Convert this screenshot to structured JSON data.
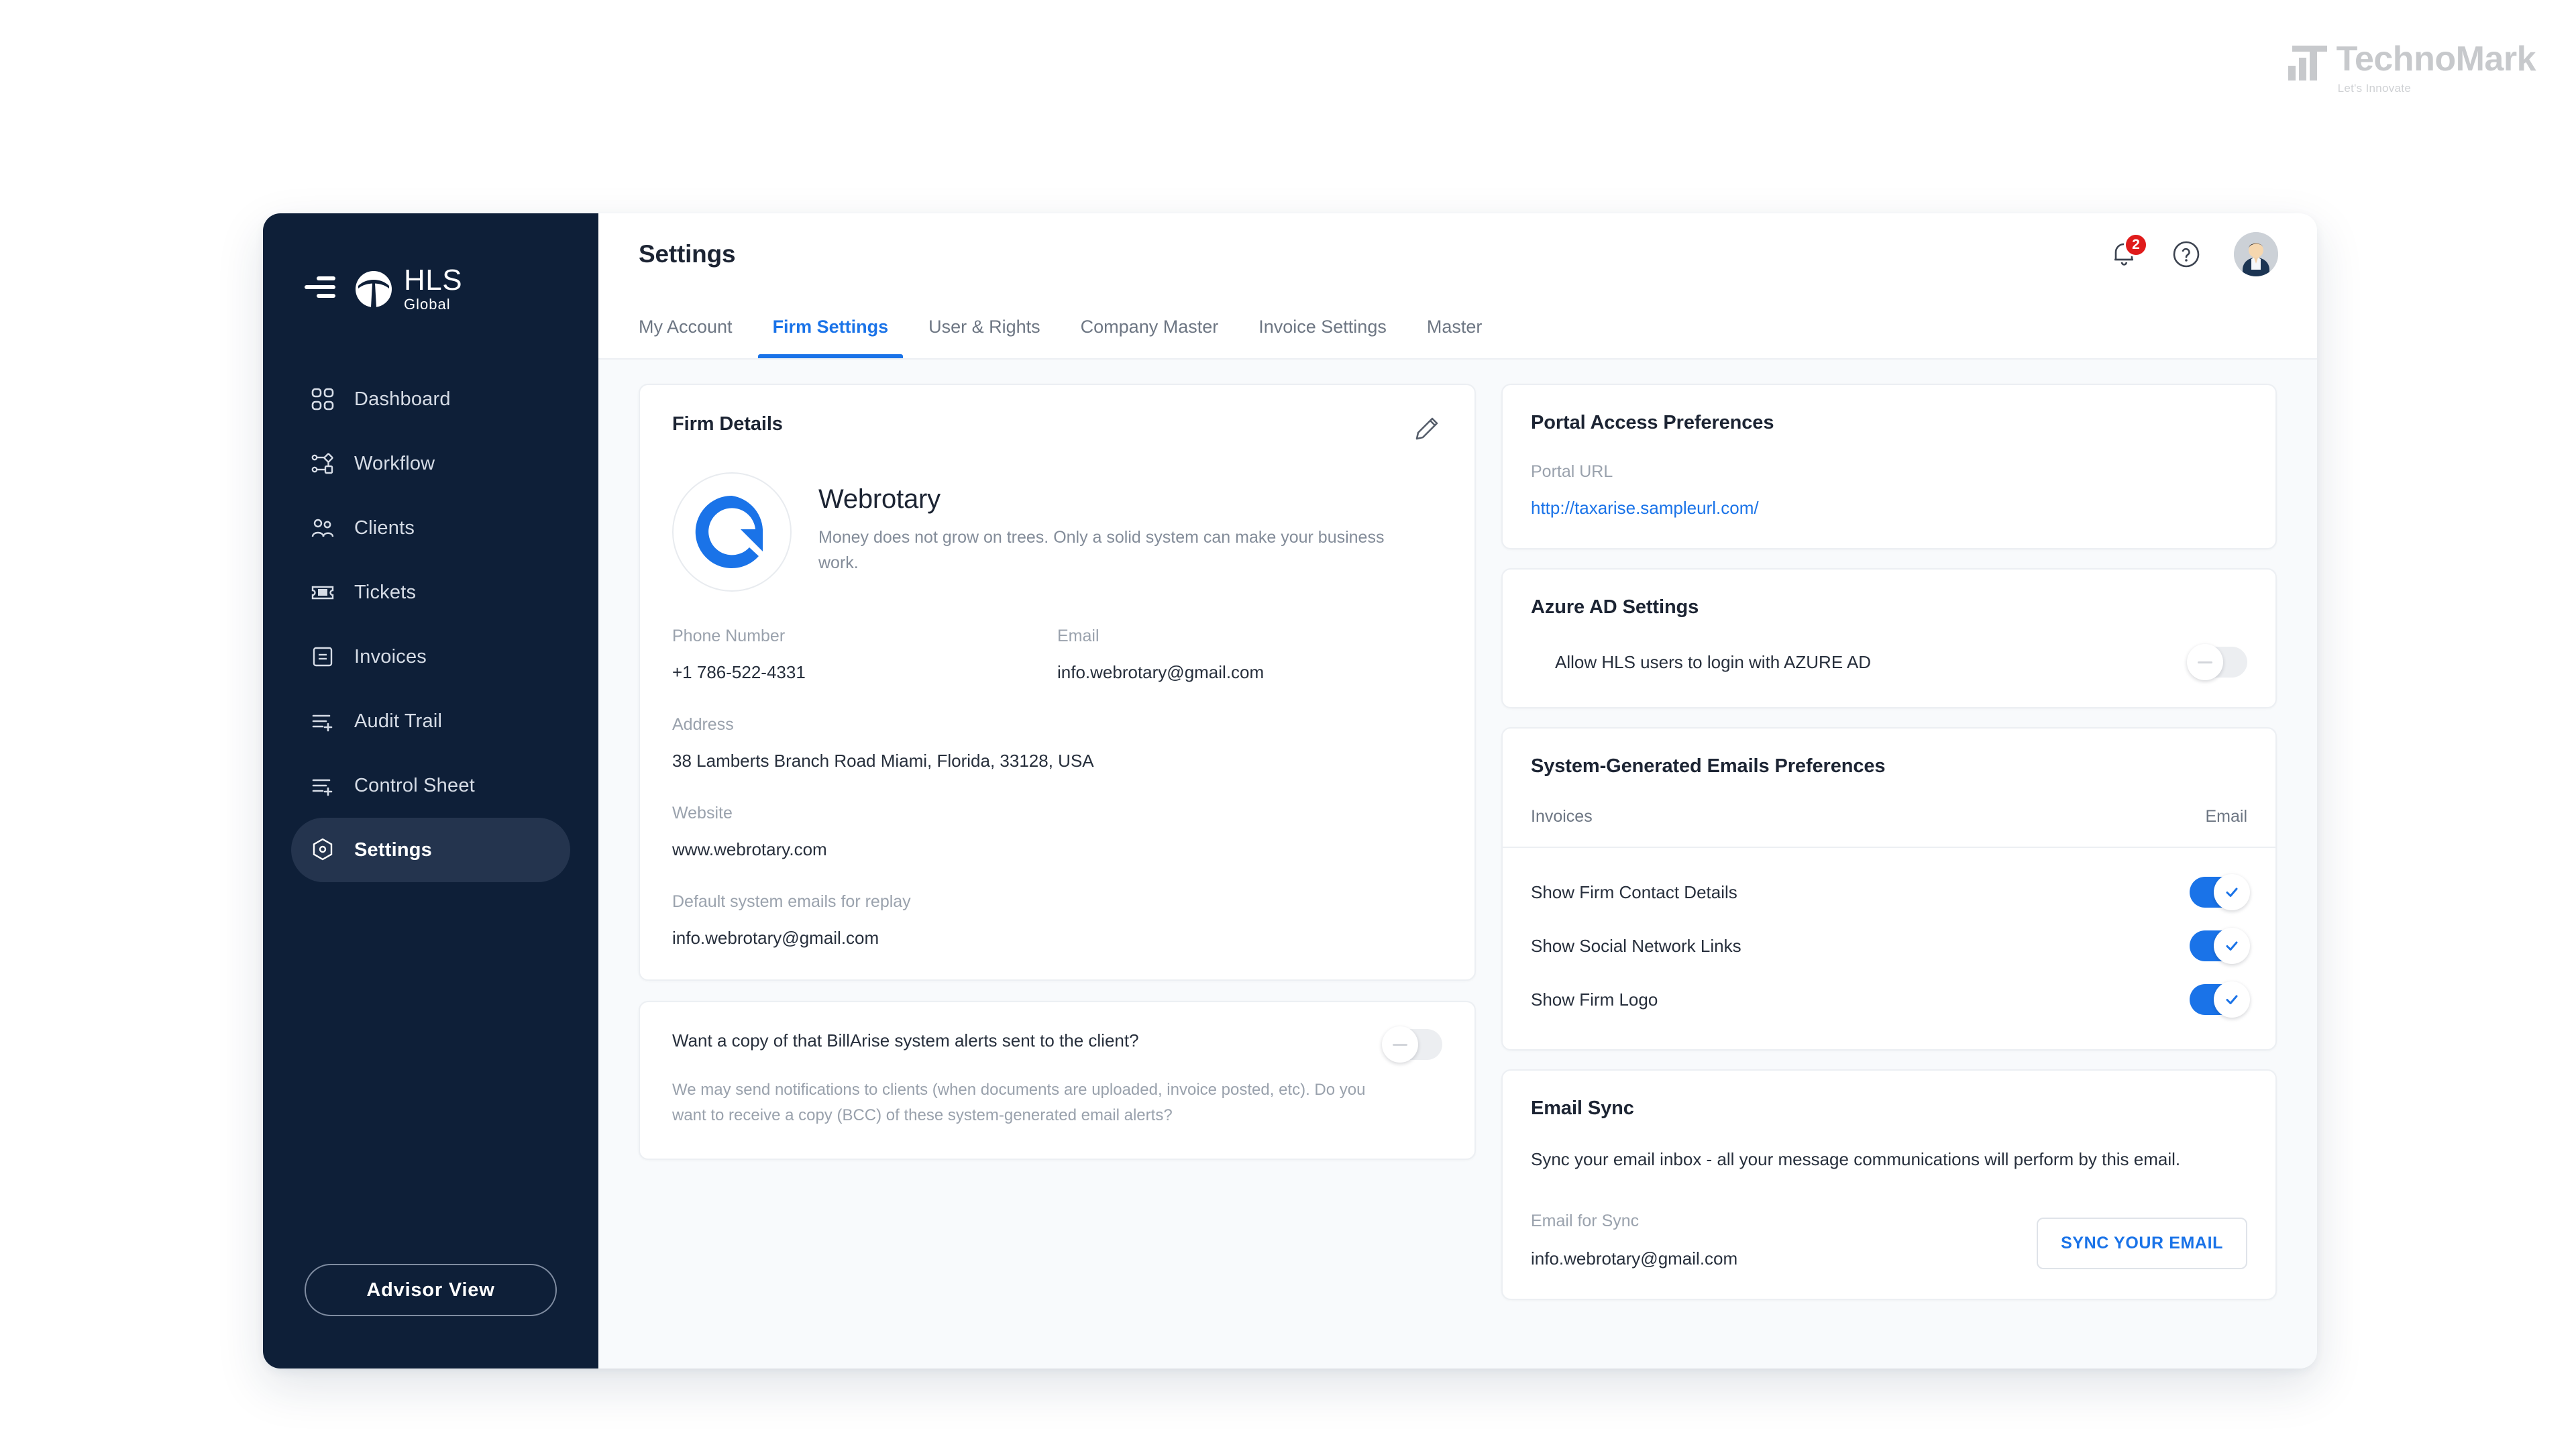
{
  "brandmark": {
    "name": "TechnoMark",
    "tagline": "Let's Innovate"
  },
  "sidebar": {
    "logo_primary": "HLS",
    "logo_secondary": "Global",
    "items": [
      {
        "label": "Dashboard",
        "icon": "grid-icon",
        "active": false
      },
      {
        "label": "Workflow",
        "icon": "workflow-icon",
        "active": false
      },
      {
        "label": "Clients",
        "icon": "users-icon",
        "active": false
      },
      {
        "label": "Tickets",
        "icon": "ticket-icon",
        "active": false
      },
      {
        "label": "Invoices",
        "icon": "invoice-icon",
        "active": false
      },
      {
        "label": "Audit Trail",
        "icon": "list-plus-icon",
        "active": false
      },
      {
        "label": "Control Sheet",
        "icon": "list-plus-icon",
        "active": false
      },
      {
        "label": "Settings",
        "icon": "gear-hex-icon",
        "active": true
      }
    ],
    "advisor_button": "Advisor  View"
  },
  "topbar": {
    "title": "Settings",
    "notification_count": "2",
    "help_icon": "question-circle-icon",
    "bell_icon": "bell-icon",
    "avatar": "user-avatar"
  },
  "tabs": [
    {
      "label": "My Account",
      "active": false
    },
    {
      "label": "Firm Settings",
      "active": true
    },
    {
      "label": "User & Rights",
      "active": false
    },
    {
      "label": "Company Master",
      "active": false
    },
    {
      "label": "Invoice Settings",
      "active": false
    },
    {
      "label": "Master",
      "active": false
    }
  ],
  "firm_details": {
    "card_title": "Firm Details",
    "edit_icon": "pencil-icon",
    "logo": "webrotary-logo",
    "name": "Webrotary",
    "description": "Money does not grow on trees. Only a solid system can make your business work.",
    "phone_label": "Phone Number",
    "phone_value": "+1 786-522-4331",
    "email_label": "Email",
    "email_value": "info.webrotary@gmail.com",
    "address_label": "Address",
    "address_value": "38 Lamberts Branch Road Miami, Florida, 33128, USA",
    "website_label": "Website",
    "website_value": "www.webrotary.com",
    "default_emails_label": "Default system emails for replay",
    "default_emails_value": "info.webrotary@gmail.com"
  },
  "alerts": {
    "question": "Want a copy of that BillArise system alerts sent to the client?",
    "paragraph": "We may send notifications to clients (when documents are uploaded, invoice posted, etc). Do you want to receive a copy (BCC) of these system-generated email alerts?",
    "toggle_state": "off"
  },
  "portal": {
    "card_title": "Portal Access Preferences",
    "url_label": "Portal URL",
    "url_value": "http://taxarise.sampleurl.com/"
  },
  "azure": {
    "card_title": "Azure AD Settings",
    "row_label": "Allow HLS users to login with AZURE AD",
    "toggle_state": "off"
  },
  "emails_prefs": {
    "card_title": "System-Generated Emails Preferences",
    "col_left": "Invoices",
    "col_right": "Email",
    "rows": [
      {
        "label": "Show Firm Contact Details",
        "toggle_state": "on"
      },
      {
        "label": "Show Social Network Links",
        "toggle_state": "on"
      },
      {
        "label": "Show Firm Logo",
        "toggle_state": "on"
      }
    ]
  },
  "email_sync": {
    "card_title": "Email Sync",
    "description": "Sync your email inbox - all your message communications will perform by this email.",
    "email_label": "Email for Sync",
    "email_value": "info.webrotary@gmail.com",
    "button_label": "SYNC YOUR EMAIL"
  },
  "colors": {
    "sidebar_bg": "#0e1f38",
    "accent_blue": "#1a73e8",
    "badge_red": "#e01b1b",
    "page_bg": "#f8fafc",
    "logo_blue": "#1a73e8"
  }
}
